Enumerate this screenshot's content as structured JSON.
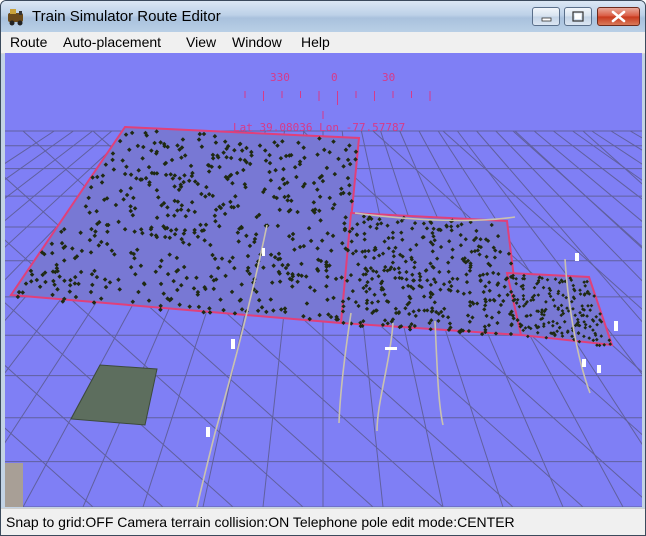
{
  "window": {
    "title": "Train Simulator Route Editor",
    "icon": "train-app-icon",
    "controls": [
      "minimize-icon",
      "maximize-icon",
      "close-icon"
    ]
  },
  "menu": {
    "items": [
      {
        "label": "Route"
      },
      {
        "label": "Auto-placement"
      },
      {
        "label": "View"
      },
      {
        "label": "Window"
      },
      {
        "label": "Help"
      }
    ]
  },
  "viewport": {
    "compass": {
      "ticks": [
        "330",
        "0",
        "30"
      ],
      "coords": "Lat 39.08036 Lon -77.57787"
    },
    "colors": {
      "sky": "#7f7ff5",
      "grid": "#5b5b8f",
      "tile_border": "#e0407a",
      "compass": "#d63a8a",
      "trees": "#1f2a12"
    }
  },
  "statusbar": {
    "text": "Snap to grid:OFF Camera terrain collision:ON Telephone pole edit mode:CENTER"
  }
}
